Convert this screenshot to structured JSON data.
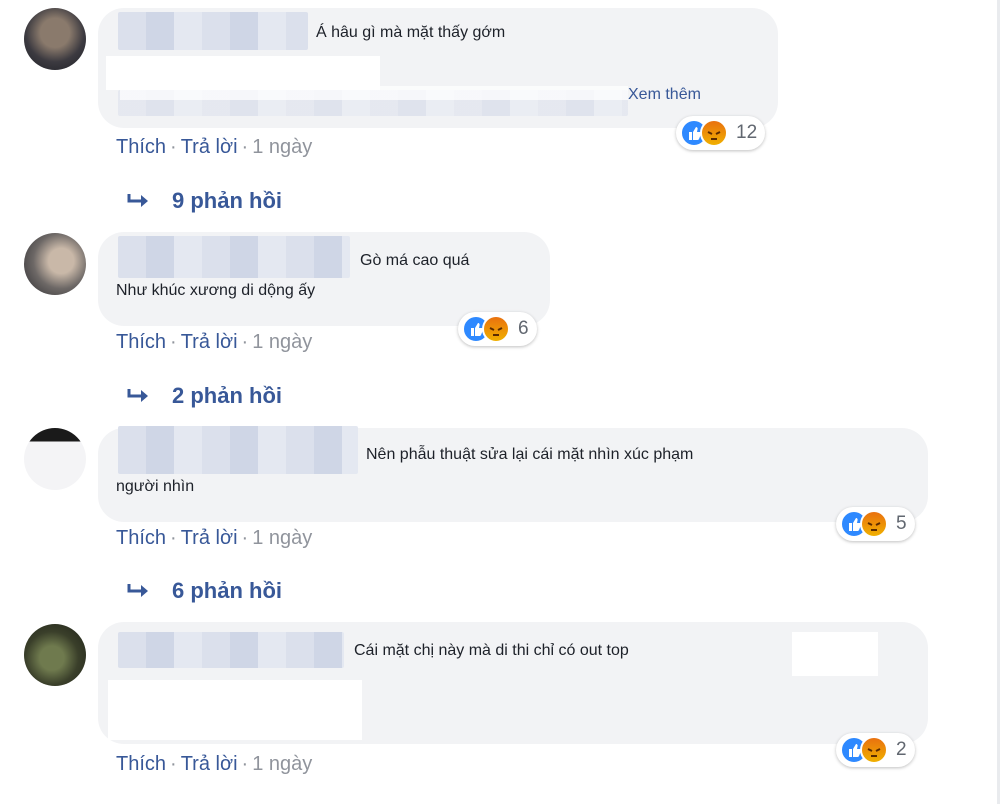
{
  "comments": [
    {
      "text": "Á hâu gì mà mặt thấy gớm",
      "see_more": "Xem thêm",
      "reaction_count": "12",
      "actions": {
        "like": "Thích",
        "reply": "Trả lời",
        "time": "1 ngày"
      },
      "replies": "9 phản hồi"
    },
    {
      "text_line1": "Gò má cao quá",
      "text_line2": "Như khúc xương di dộng ấy",
      "reaction_count": "6",
      "actions": {
        "like": "Thích",
        "reply": "Trả lời",
        "time": "1 ngày"
      },
      "replies": "2 phản hồi"
    },
    {
      "text_line1": "Nên phẫu thuật sửa lại cái mặt nhìn xúc phạm",
      "text_line2": "người nhìn",
      "reaction_count": "5",
      "actions": {
        "like": "Thích",
        "reply": "Trả lời",
        "time": "1 ngày"
      },
      "replies": "6 phản hồi"
    },
    {
      "text": "Cái mặt chị này mà di thi chỉ có out top",
      "reaction_count": "2",
      "actions": {
        "like": "Thích",
        "reply": "Trả lời",
        "time": "1 ngày"
      }
    }
  ],
  "colors": {
    "link": "#385898",
    "bubble": "#f2f3f5",
    "like": "#2e89ff",
    "angry": "#f0a000"
  }
}
